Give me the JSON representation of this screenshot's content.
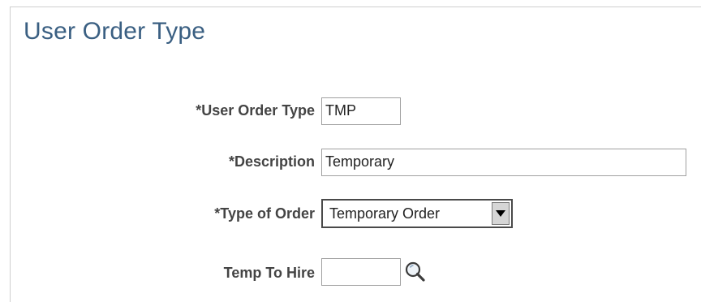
{
  "page": {
    "title": "User Order Type"
  },
  "form": {
    "user_order_type": {
      "label": "*User Order Type",
      "value": "TMP"
    },
    "description": {
      "label": "*Description",
      "value": "Temporary"
    },
    "type_of_order": {
      "label": "*Type of Order",
      "selected": "Temporary Order"
    },
    "temp_to_hire": {
      "label": "Temp To Hire",
      "value": "",
      "lookup_icon": "magnifier-icon"
    }
  },
  "colors": {
    "title": "#3a5f82",
    "label": "#444444",
    "field_border": "#a0a0a0",
    "select_border": "#4a4a4a"
  }
}
